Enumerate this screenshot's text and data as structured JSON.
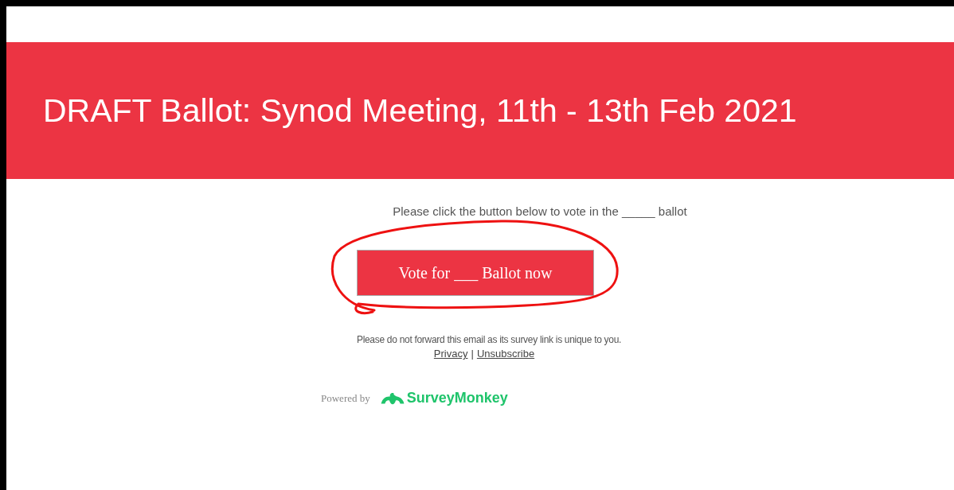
{
  "header": {
    "title": "DRAFT Ballot: Synod Meeting, 11th - 13th Feb 2021"
  },
  "intro": "Please click the button below to vote in the _____ ballot",
  "vote_button": {
    "label": "Vote for ___ Ballot now",
    "circled": true
  },
  "notice": "Please do not forward this email as its survey link is unique to you.",
  "links": [
    "Privacy",
    "Unsubscribe"
  ],
  "link_separator": "|",
  "footer": {
    "powered_by": "Powered by",
    "brand": "SurveyMonkey"
  }
}
